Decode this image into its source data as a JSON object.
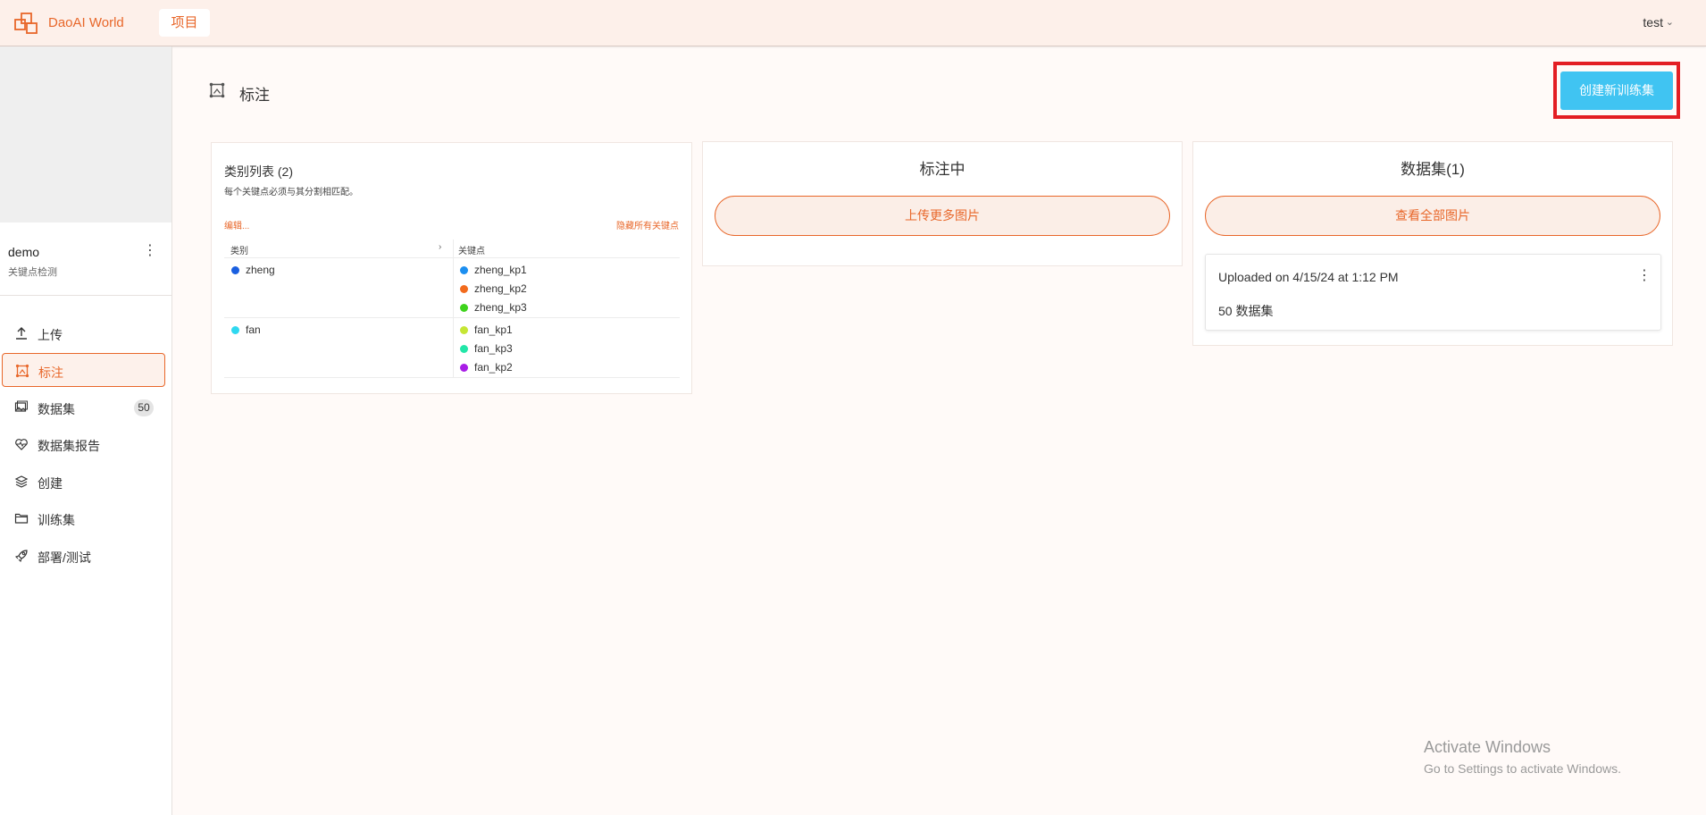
{
  "app": {
    "brand": "DaoAI World",
    "nav_project": "项目",
    "user": "test"
  },
  "sidebar": {
    "project_name": "demo",
    "project_type": "关键点检测",
    "items": [
      {
        "label": "上传",
        "icon": "upload-icon"
      },
      {
        "label": "标注",
        "icon": "annotate-icon"
      },
      {
        "label": "数据集",
        "icon": "images-icon",
        "badge": "50"
      },
      {
        "label": "数据集报告",
        "icon": "heart-pulse-icon"
      },
      {
        "label": "创建",
        "icon": "layers-icon"
      },
      {
        "label": "训练集",
        "icon": "folder-icon"
      },
      {
        "label": "部署/测试",
        "icon": "rocket-icon"
      }
    ]
  },
  "header": {
    "title": "标注",
    "create_button": "创建新训练集"
  },
  "categories_panel": {
    "title": "类别列表 (2)",
    "subtitle": "每个关键点必须与其分割相匹配。",
    "edit_link": "编辑...",
    "hide_link": "隐藏所有关键点",
    "col_category": "类别",
    "col_keypoints": "关键点",
    "rows": [
      {
        "category": "zheng",
        "color": "#1a5fe0",
        "keypoints": [
          {
            "name": "zheng_kp1",
            "color": "#1c8ff0"
          },
          {
            "name": "zheng_kp2",
            "color": "#f26b1d"
          },
          {
            "name": "zheng_kp3",
            "color": "#3ed31c"
          }
        ]
      },
      {
        "category": "fan",
        "color": "#2fd8f0",
        "keypoints": [
          {
            "name": "fan_kp1",
            "color": "#c6e634"
          },
          {
            "name": "fan_kp3",
            "color": "#22e6a8"
          },
          {
            "name": "fan_kp2",
            "color": "#a81de6"
          }
        ]
      }
    ]
  },
  "annotating_panel": {
    "title": "标注中",
    "button": "上传更多图片"
  },
  "dataset_panel": {
    "title": "数据集(1)",
    "button": "查看全部图片",
    "upload": {
      "title": "Uploaded on 4/15/24 at 1:12 PM",
      "count": "50 数据集"
    }
  },
  "watermark": {
    "line1": "Activate Windows",
    "line2": "Go to Settings to activate Windows."
  },
  "colors": {
    "accent": "#e8672a",
    "primary_button": "#40c4f2",
    "highlight_frame": "#e31e24"
  }
}
